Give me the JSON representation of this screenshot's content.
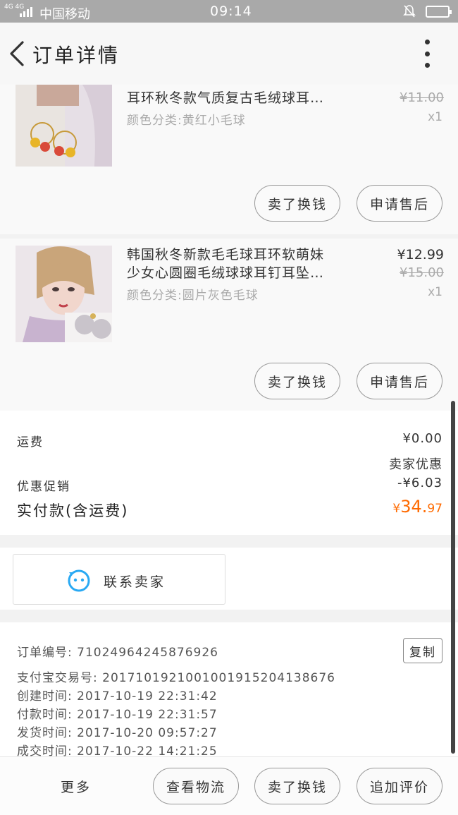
{
  "status_bar": {
    "network": "4G 4G",
    "carrier": "中国移动",
    "time": "09:14"
  },
  "nav": {
    "title": "订单详情"
  },
  "items": [
    {
      "name_line1": "",
      "name_line2": "耳环秋冬款气质复古毛绒球耳…",
      "spec": "颜色分类:黄红小毛球",
      "price": "",
      "original_price": "¥11.00",
      "qty": "x1",
      "btn_refund": "卖了换钱",
      "btn_aftersale": "申请售后"
    },
    {
      "name_line1": "韩国秋冬新款毛毛球耳环软萌妹",
      "name_line2": "少女心圆圈毛绒球球耳钉耳坠…",
      "spec": "颜色分类:圆片灰色毛球",
      "price": "¥12.99",
      "original_price": "¥15.00",
      "qty": "x1",
      "btn_refund": "卖了换钱",
      "btn_aftersale": "申请售后"
    }
  ],
  "fees": {
    "shipping_label": "运费",
    "shipping_value": "¥0.00",
    "seller_discount_label": "卖家优惠",
    "promo_label": "优惠促销",
    "promo_value": "-¥6.03",
    "total_label": "实付款(含运费)",
    "total_symbol": "¥",
    "total_int": "34.",
    "total_dec": "97"
  },
  "contact": {
    "label": "联系卖家"
  },
  "order_info": {
    "order_no": "订单编号: 71024964245876926",
    "copy_label": "复制",
    "alipay_no": "支付宝交易号: 2017101921001001915204138676",
    "created": "创建时间: 2017-10-19 22:31:42",
    "paid": "付款时间: 2017-10-19 22:31:57",
    "shipped": "发货时间: 2017-10-20 09:57:27",
    "completed": "成交时间: 2017-10-22 14:21:25"
  },
  "bottom_bar": {
    "more": "更多",
    "logistics": "查看物流",
    "sell": "卖了换钱",
    "review": "追加评价"
  },
  "colors": {
    "accent_orange": "#ff6a00",
    "contact_icon_blue": "#29a9f3"
  }
}
